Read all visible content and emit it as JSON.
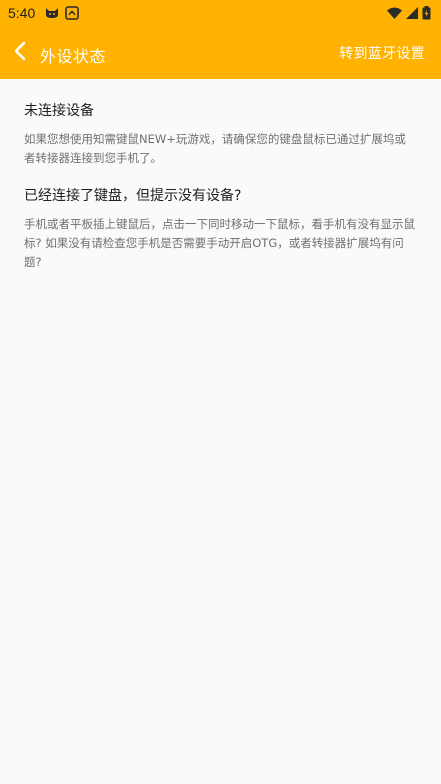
{
  "status_bar": {
    "time": "5:40",
    "left_icons": [
      "cat-notification-icon",
      "app-notification-icon"
    ],
    "right_icons": [
      "wifi-icon",
      "cellular-signal-icon",
      "battery-charging-icon"
    ]
  },
  "app_bar": {
    "title": "外设状态",
    "action_label": "转到蓝牙设置",
    "background": "#FFB300"
  },
  "sections": [
    {
      "title": "未连接设备",
      "body": "如果您想使用知需键鼠NEW+玩游戏，请确保您的键盘鼠标已通过扩展坞或者转接器连接到您手机了。"
    },
    {
      "title": "已经连接了键盘，但提示没有设备?",
      "body": "手机或者平板插上键鼠后，点击一下同时移动一下鼠标，看手机有没有显示鼠标? 如果没有请检查您手机是否需要手动开启OTG，或者转接器扩展坞有问题?"
    }
  ]
}
